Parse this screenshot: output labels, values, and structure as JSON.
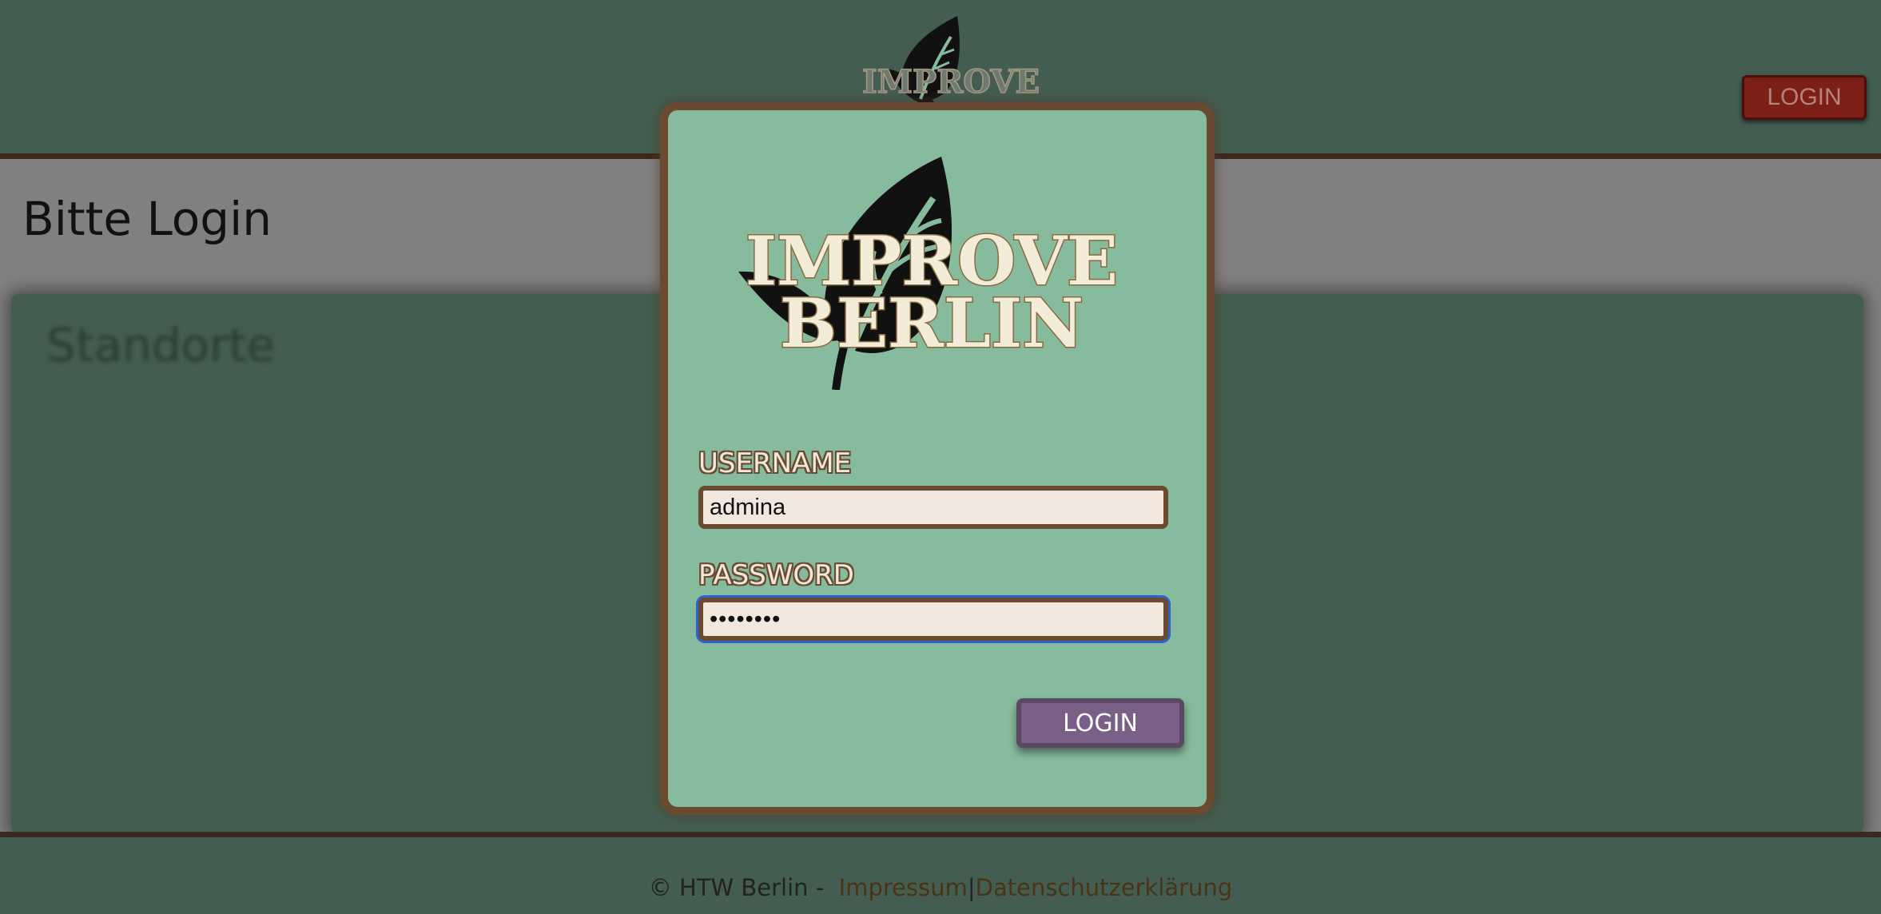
{
  "header": {
    "logo_text_line1": "IMPROVE",
    "logo_text_line2": "BERLIN",
    "login_label": "LOGIN"
  },
  "page": {
    "title": "Bitte Login",
    "panel_title": "Standorte"
  },
  "footer": {
    "copyright": "© HTW Berlin - ",
    "impressum": "Impressum",
    "separator": "|",
    "privacy": "Datenschutzerklärung"
  },
  "login_modal": {
    "logo_text_line1": "IMPROVE",
    "logo_text_line2": "BERLIN",
    "username_label": "USERNAME",
    "username_value": "admina",
    "password_label": "PASSWORD",
    "password_value": "••••••••",
    "submit_label": "LOGIN"
  },
  "colors": {
    "header_bg": "#435e50",
    "modal_bg": "#86bc9d",
    "modal_border": "#6b4a32",
    "header_login_bg": "#7b1f17",
    "modal_login_bg": "#7a5f87",
    "overlay": "#808080"
  },
  "icons": {
    "leaf": "leaf-icon"
  }
}
